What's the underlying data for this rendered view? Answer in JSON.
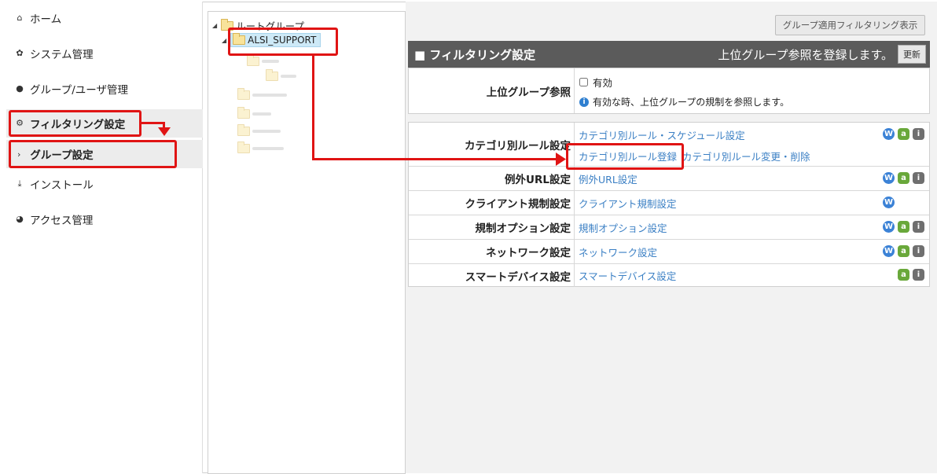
{
  "sidebar": {
    "items": [
      {
        "label": "ホーム",
        "icon": "home-icon"
      },
      {
        "label": "システム管理",
        "icon": "gear-icon"
      },
      {
        "label": "グループ/ユーザ管理",
        "icon": "users-icon"
      },
      {
        "label": "フィルタリング設定",
        "icon": "cogs-icon"
      },
      {
        "label": "グループ設定",
        "icon": "chevron-right-icon"
      },
      {
        "label": "インストール",
        "icon": "download-icon"
      },
      {
        "label": "アクセス管理",
        "icon": "pie-chart-icon"
      }
    ]
  },
  "tree": {
    "root_label": "ルートグループ",
    "selected_label": "ALSI_SUPPORT",
    "blurred_items": [
      "xxxx",
      "xxxx",
      "xxxxxxxx",
      "xxxxx",
      "xxxxxx",
      "xxxxxxx"
    ]
  },
  "toolbar": {
    "group_filter_button": "グループ適用フィルタリング表示"
  },
  "section": {
    "title": "■ フィルタリング設定",
    "note": "上位グループ参照を登録します。",
    "update_button": "更新"
  },
  "parent_ref": {
    "label": "上位グループ参照",
    "checkbox_label": "有効",
    "checked": false,
    "info_text": "有効な時、上位グループの規制を参照します。"
  },
  "rules": [
    {
      "label": "カテゴリ別ルール設定",
      "links": [
        "カテゴリ別ルール・スケジュール設定",
        "カテゴリ別ルール登録",
        "カテゴリ別ルール変更・削除"
      ],
      "badges": [
        "w",
        "a",
        "i"
      ]
    },
    {
      "label": "例外URL設定",
      "links": [
        "例外URL設定"
      ],
      "badges": [
        "w",
        "a",
        "i"
      ]
    },
    {
      "label": "クライアント規制設定",
      "links": [
        "クライアント規制設定"
      ],
      "badges": [
        "w"
      ]
    },
    {
      "label": "規制オプション設定",
      "links": [
        "規制オプション設定"
      ],
      "badges": [
        "w",
        "a",
        "i"
      ]
    },
    {
      "label": "ネットワーク設定",
      "links": [
        "ネットワーク設定"
      ],
      "badges": [
        "w",
        "a",
        "i"
      ]
    },
    {
      "label": "スマートデバイス設定",
      "links": [
        "スマートデバイス設定"
      ],
      "badges": [
        "a",
        "i"
      ]
    }
  ],
  "badge_glyphs": {
    "w": "W",
    "a": "a",
    "i": "i"
  },
  "colors": {
    "accent_red": "#e01414",
    "link_blue": "#3a7fc4",
    "header_gray": "#5b5b5b",
    "badge_w": "#3b82d6",
    "badge_a": "#69a83a",
    "badge_i": "#6f6f6f"
  }
}
